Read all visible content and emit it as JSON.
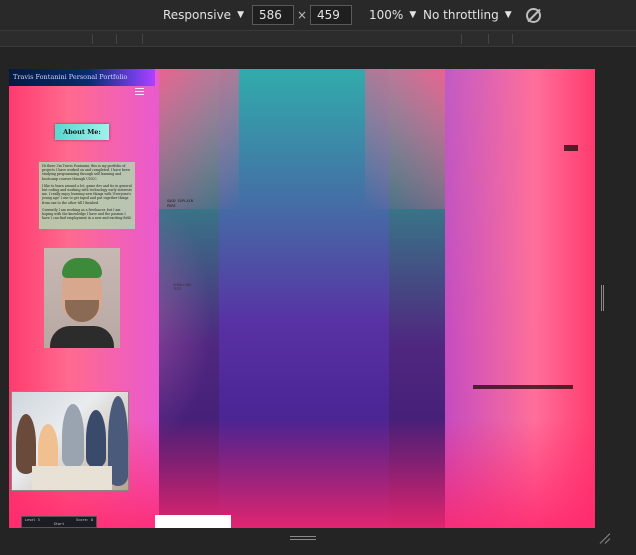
{
  "toolbar": {
    "device": "Responsive",
    "width": "586",
    "height": "459",
    "dim_separator": "×",
    "zoom": "100%",
    "throttling": "No throttling",
    "caret": "▼"
  },
  "page": {
    "header_title": "Travis Fontanini Personal Portfolio",
    "about_button": "About Me:",
    "bio_paragraphs": [
      "Hi there I'm Travis Fontanini, this is my portfolio of projects I have worked on and completed. I have been studying programming through self learning and bootcamp courses through UNCC.",
      "I like to learn around a lot, game dev and tie in general but coding and working with technology early interests me. I really enjoy learning new things with 'Everyone's young age' I use to get taped and put together things from one to the other till I finished.",
      "Currently I am working as a freelancer, but I am hoping with the knowledge I have and the passion I have I can find employment in a new and exciting field."
    ],
    "good_exp_text": "GOOD EXPLAIN PURE",
    "scroll_label": "SCROLLING TEXT",
    "mini_game": {
      "row1_left": "Level 3",
      "row1_right": "Score: 8",
      "row2": "Start"
    }
  },
  "colors": {
    "toolbar_bg": "#292929",
    "header_gradient_start": "#061a3d",
    "header_gradient_end": "#b040ff",
    "about_button_bg": "#56d8d0",
    "bio_bg": "#afd7af"
  }
}
